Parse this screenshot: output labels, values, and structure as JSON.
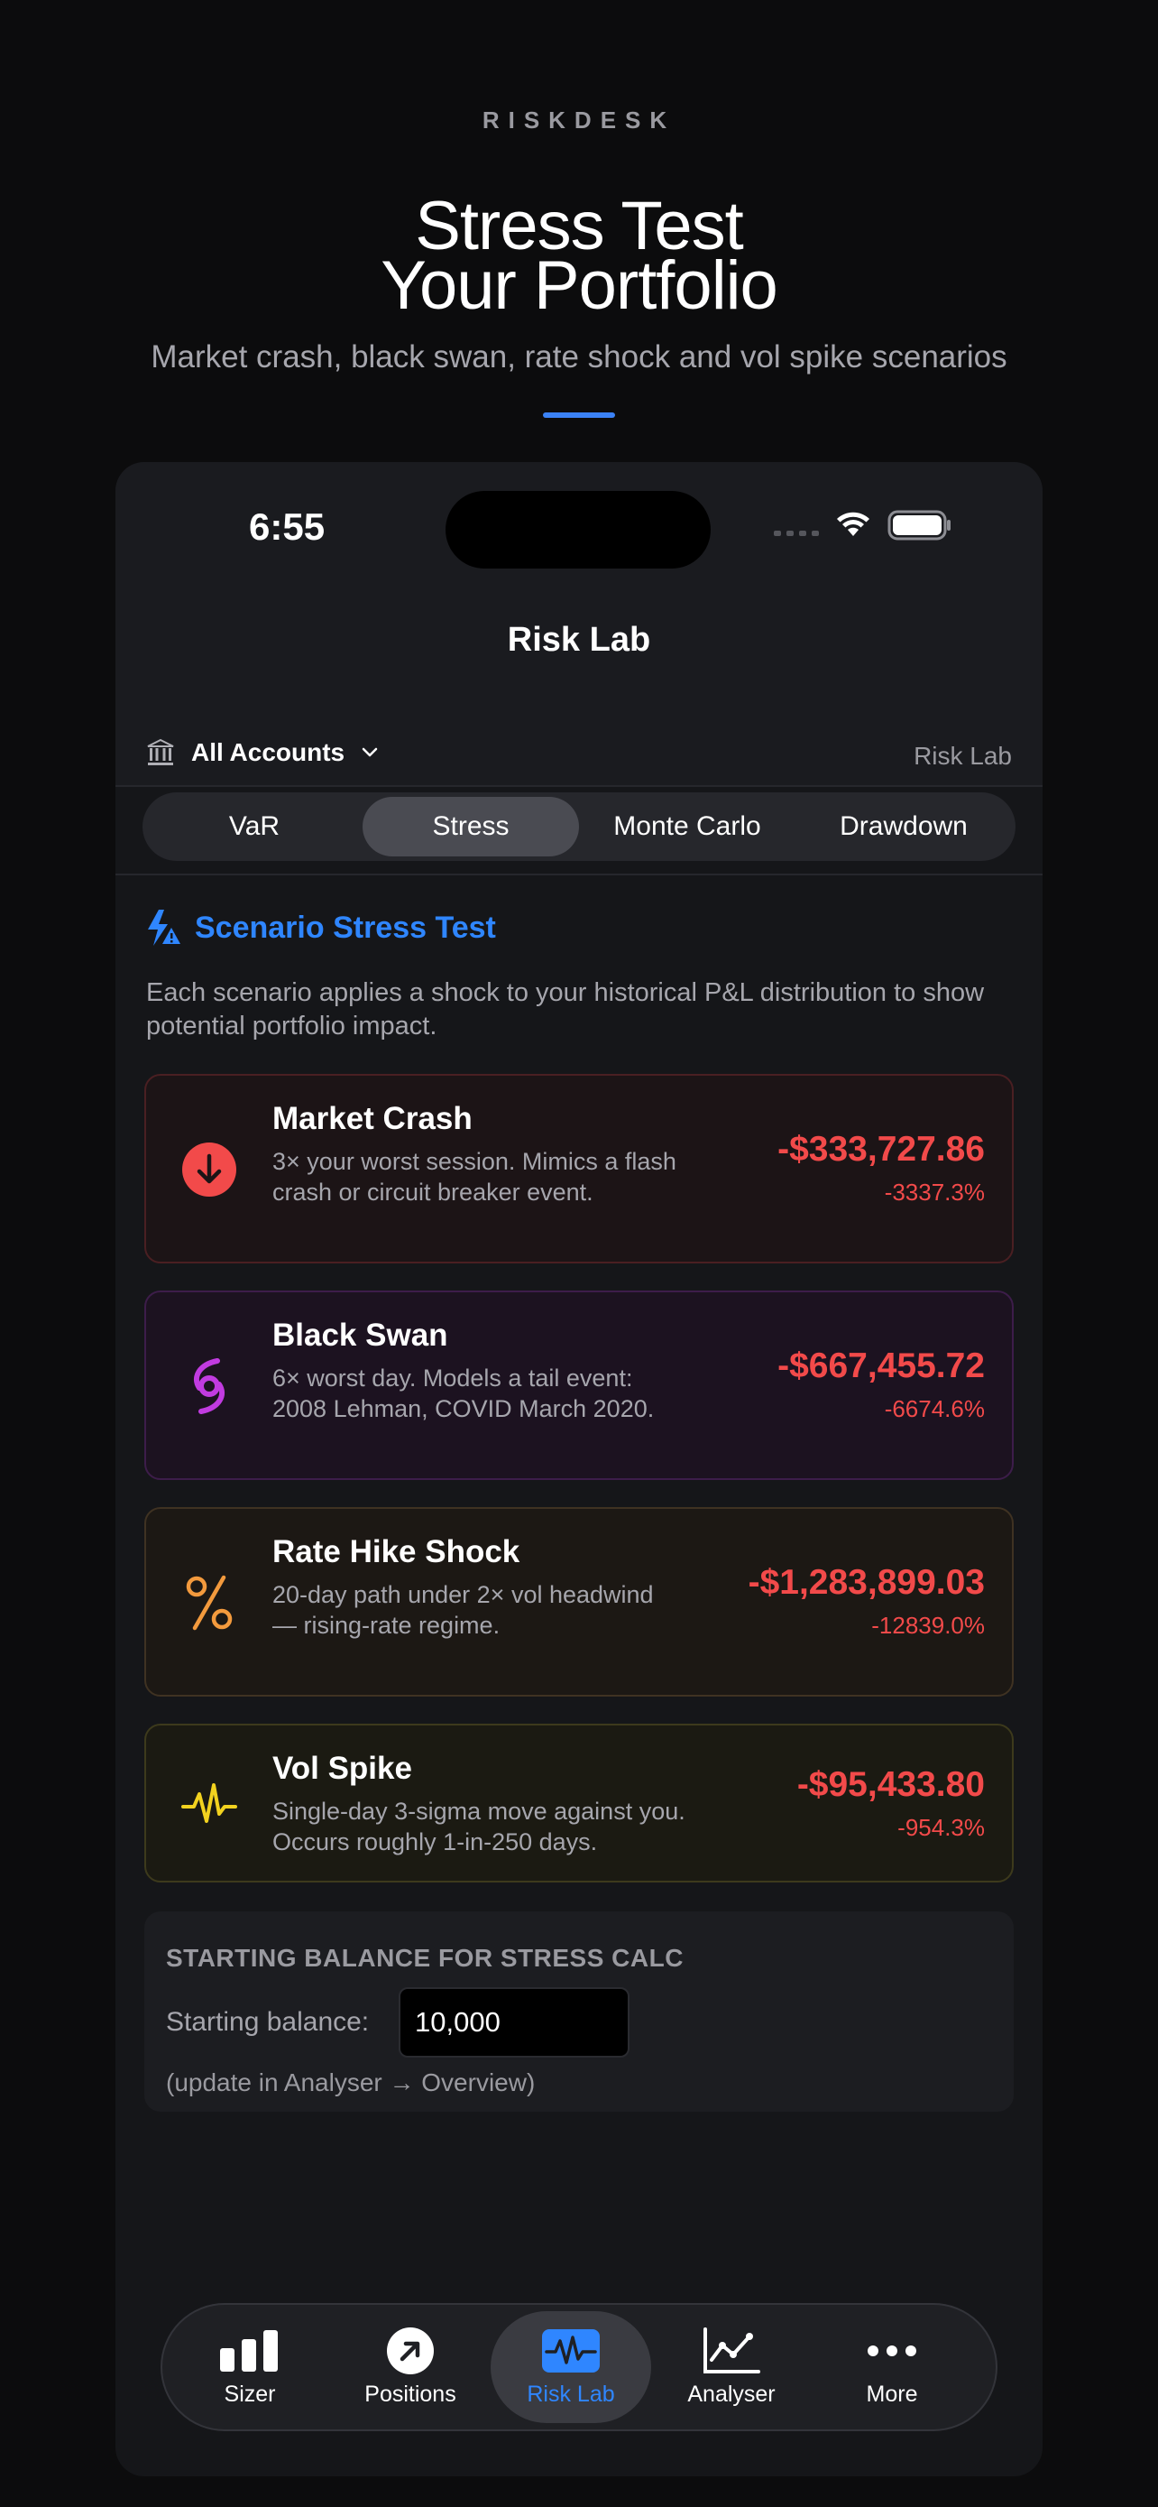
{
  "brand": "RISKDESK",
  "headline": {
    "line1": "Stress Test",
    "line2": "Your Portfolio"
  },
  "subhead": "Market crash, black swan, rate shock and vol spike scenarios",
  "status_bar": {
    "time": "6:55"
  },
  "nav": {
    "title": "Risk Lab"
  },
  "accounts": {
    "selector_label": "All Accounts",
    "right_label": "Risk Lab"
  },
  "segments": [
    {
      "label": "VaR",
      "active": false
    },
    {
      "label": "Stress",
      "active": true
    },
    {
      "label": "Monte Carlo",
      "active": false
    },
    {
      "label": "Drawdown",
      "active": false
    }
  ],
  "section": {
    "title": "Scenario Stress Test",
    "intro": "Each scenario applies a shock to your historical P&L distribution to show potential portfolio impact."
  },
  "scenarios": [
    {
      "title": "Market Crash",
      "description": "3× your worst session. Mimics a flash crash or circuit breaker event.",
      "amount": "-$333,727.86",
      "percent": "-3337.3%",
      "icon": "arrow-down-circle-icon",
      "accent": "#f24a4a"
    },
    {
      "title": "Black Swan",
      "description": "6× worst day. Models a tail event: 2008 Lehman, COVID March 2020.",
      "amount": "-$667,455.72",
      "percent": "-6674.6%",
      "icon": "hurricane-icon",
      "accent": "#c13be0"
    },
    {
      "title": "Rate Hike Shock",
      "description": "20-day path under 2× vol headwind — rising-rate regime.",
      "amount": "-$1,283,899.03",
      "percent": "-12839.0%",
      "icon": "percent-icon",
      "accent": "#f39a3d"
    },
    {
      "title": "Vol Spike",
      "description": "Single-day 3-sigma move against you. Occurs roughly 1-in-250 days.",
      "amount": "-$95,433.80",
      "percent": "-954.3%",
      "icon": "waveform-icon",
      "accent": "#f2d21f"
    }
  ],
  "balance": {
    "title": "STARTING BALANCE FOR STRESS CALC",
    "label": "Starting balance:",
    "value": "10,000",
    "note": "(update in Analyser → Overview)"
  },
  "tabbar": [
    {
      "label": "Sizer",
      "icon": "bar-chart-icon",
      "active": false
    },
    {
      "label": "Positions",
      "icon": "arrow-up-right-circle-icon",
      "active": false
    },
    {
      "label": "Risk Lab",
      "icon": "waveform-box-icon",
      "active": true
    },
    {
      "label": "Analyser",
      "icon": "line-chart-icon",
      "active": false
    },
    {
      "label": "More",
      "icon": "more-icon",
      "active": false
    }
  ],
  "colors": {
    "accent_blue": "#2f86ff",
    "loss_red": "#f24a4a",
    "background": "#0c0c0d"
  }
}
